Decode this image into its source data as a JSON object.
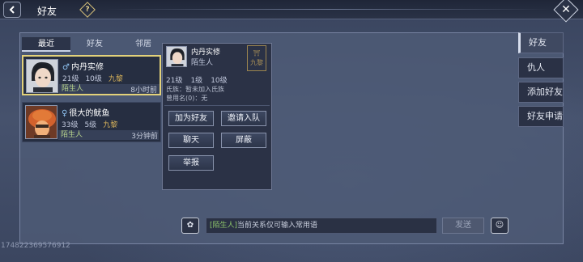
{
  "header": {
    "title": "好友",
    "back_icon": "left-chevron-icon",
    "help_icon": "help-diamond-icon",
    "close_icon": "close-icon",
    "help_glyph": "?"
  },
  "friend_tabs": [
    {
      "label": "最近",
      "active": true
    },
    {
      "label": "好友",
      "active": false
    },
    {
      "label": "邻居",
      "active": false
    }
  ],
  "friends": [
    {
      "name": "内丹实修",
      "gender": "♂",
      "level": "21级",
      "house": "10级",
      "guild": "九黎",
      "relation": "陌生人",
      "time": "8小时前"
    },
    {
      "name": "很大的鱿鱼",
      "gender": "♀",
      "level": "33级",
      "house": "5级",
      "guild": "九黎",
      "relation": "陌生人",
      "time": "3分钟前"
    }
  ],
  "popup": {
    "name": "内丹实修",
    "relation": "陌生人",
    "guild_badge": "九黎",
    "stats": [
      "21级",
      "1级",
      "10级"
    ],
    "guild_line": "氏族：暂未加入氏族",
    "alias_line": "曾用名(0)：无",
    "buttons": {
      "add_friend": "加为好友",
      "invite_team": "邀请入队",
      "chat": "聊天",
      "block": "屏蔽",
      "report": "举报"
    }
  },
  "right_tabs": [
    {
      "label": "好友",
      "active": true
    },
    {
      "label": "仇人",
      "active": false
    },
    {
      "label": "添加好友",
      "active": false
    },
    {
      "label": "好友申请",
      "active": false
    }
  ],
  "chat": {
    "tag": "[陌生人]",
    "hint": "当前关系仅可输入常用语",
    "send_label": "发送"
  },
  "uid": "174822369576912",
  "colors": {
    "selected_border": "#e3d27a",
    "relation_text": "#b9d58d",
    "guild_gold": "#d8b35a"
  }
}
